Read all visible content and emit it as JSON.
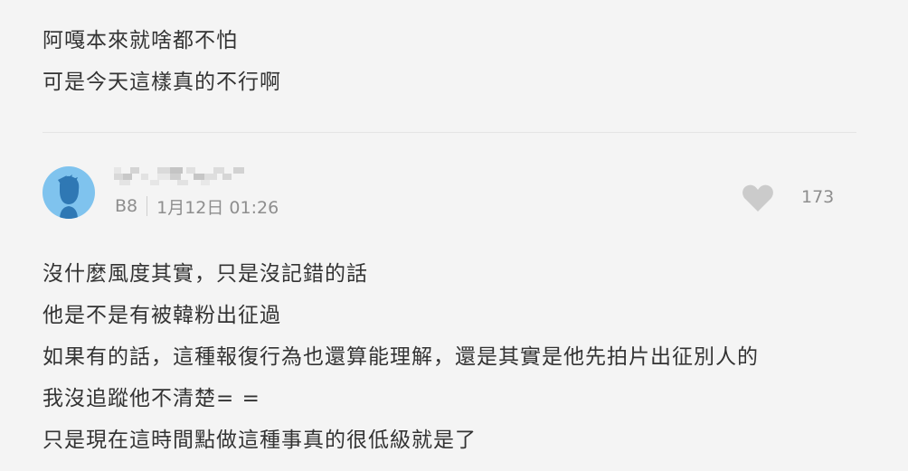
{
  "previous_post": {
    "lines": [
      "阿嘎本來就啥都不怕",
      "可是今天這樣真的不行啊"
    ]
  },
  "comment": {
    "floor": "B8",
    "datetime": "1月12日 01:26",
    "like_icon": "heart-icon",
    "likes": "173",
    "avatar_color": "#7fc3ee",
    "lines": [
      "沒什麼風度其實，只是沒記錯的話",
      "他是不是有被韓粉出征過",
      "如果有的話，這種報復行為也還算能理解，還是其實是他先拍片出征別人的",
      "我沒追蹤他不清楚= =",
      "只是現在這時間點做這種事真的很低級就是了"
    ]
  }
}
